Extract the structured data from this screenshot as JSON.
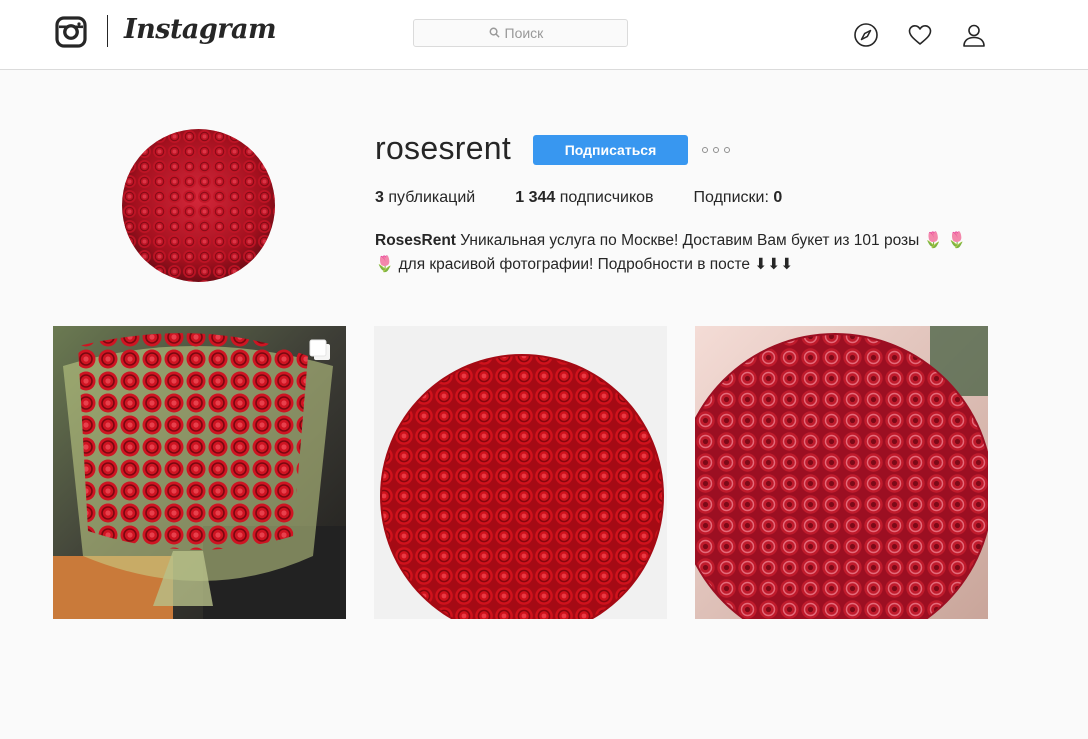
{
  "nav": {
    "brand": "Instagram",
    "search_placeholder": "Поиск",
    "icons": [
      "instagram-logo-icon",
      "explore-compass-icon",
      "activity-heart-icon",
      "profile-person-icon"
    ]
  },
  "profile": {
    "username": "rosesrent",
    "follow_label": "Подписаться",
    "stats": {
      "posts_count": "3",
      "posts_label": "публикаций",
      "followers_count": "1 344",
      "followers_label": "подписчиков",
      "following_label": "Подписки:",
      "following_count": "0"
    },
    "bio": {
      "name": "RosesRent",
      "text": "Уникальная услуга по Москве! Доставим Вам букет из 101 розы 🌷 🌷🌷 для красивой фотографии! Подробности в посте ⬇⬇⬇"
    }
  },
  "posts": [
    {
      "alt": "bouquet-in-wrapping",
      "multi": true
    },
    {
      "alt": "rose-sphere-white-bg",
      "multi": false
    },
    {
      "alt": "rose-sphere-pink-tint",
      "multi": false
    }
  ],
  "colors": {
    "accent": "#3897f0",
    "background": "#fafafa",
    "text": "#262626",
    "border": "#dbdbdb",
    "rose": "#c0141c"
  }
}
